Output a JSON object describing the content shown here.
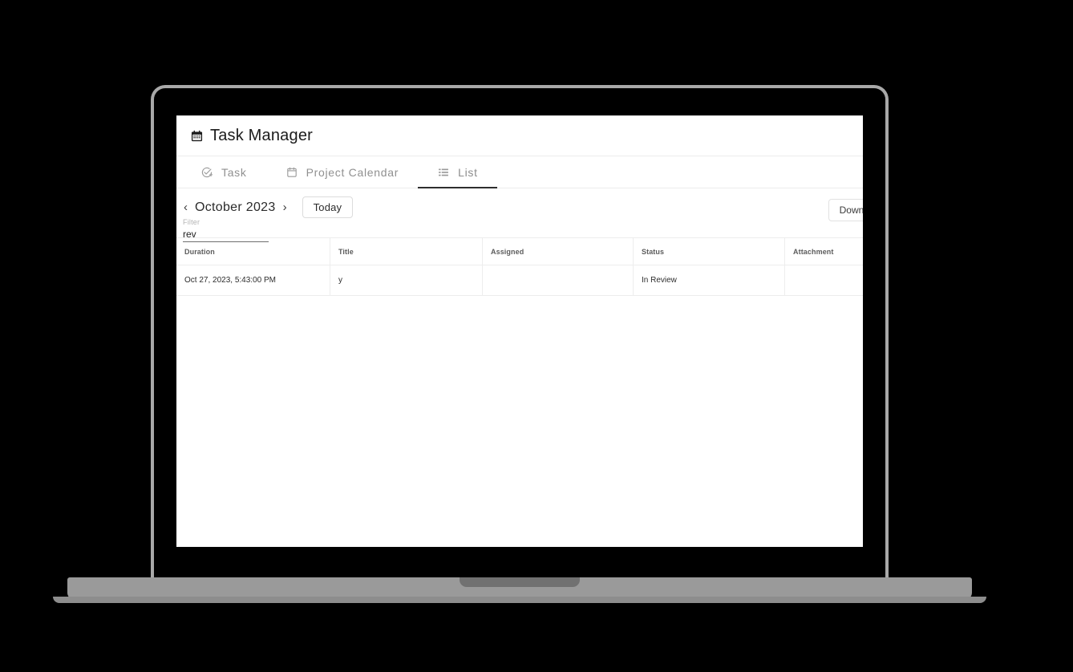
{
  "app": {
    "title": "Task Manager",
    "title_icon": "calendar-solid-icon"
  },
  "tabs": [
    {
      "label": "Task",
      "icon": "check-circle-plus-icon",
      "active": false
    },
    {
      "label": "Project Calendar",
      "icon": "calendar-outline-icon",
      "active": false
    },
    {
      "label": "List",
      "icon": "list-icon",
      "active": true
    }
  ],
  "toolbar": {
    "prev_label": "‹",
    "next_label": "›",
    "current_month": "October 2023",
    "today_label": "Today",
    "download_label": "Download"
  },
  "filter": {
    "label": "Filter",
    "value": "rev",
    "placeholder": ""
  },
  "table": {
    "columns": [
      "Duration",
      "Title",
      "Assigned",
      "Status",
      "Attachment"
    ],
    "rows": [
      {
        "duration": "Oct 27, 2023, 5:43:00 PM",
        "title": "y",
        "assigned": "",
        "status": "In Review",
        "attachment": ""
      }
    ]
  },
  "colors": {
    "background": "#000000",
    "screen": "#ffffff",
    "bezel": "#a8a8a8",
    "base": "#9a9a9a",
    "active_tab_underline": "#2e2e2e",
    "muted_text": "#909090"
  }
}
